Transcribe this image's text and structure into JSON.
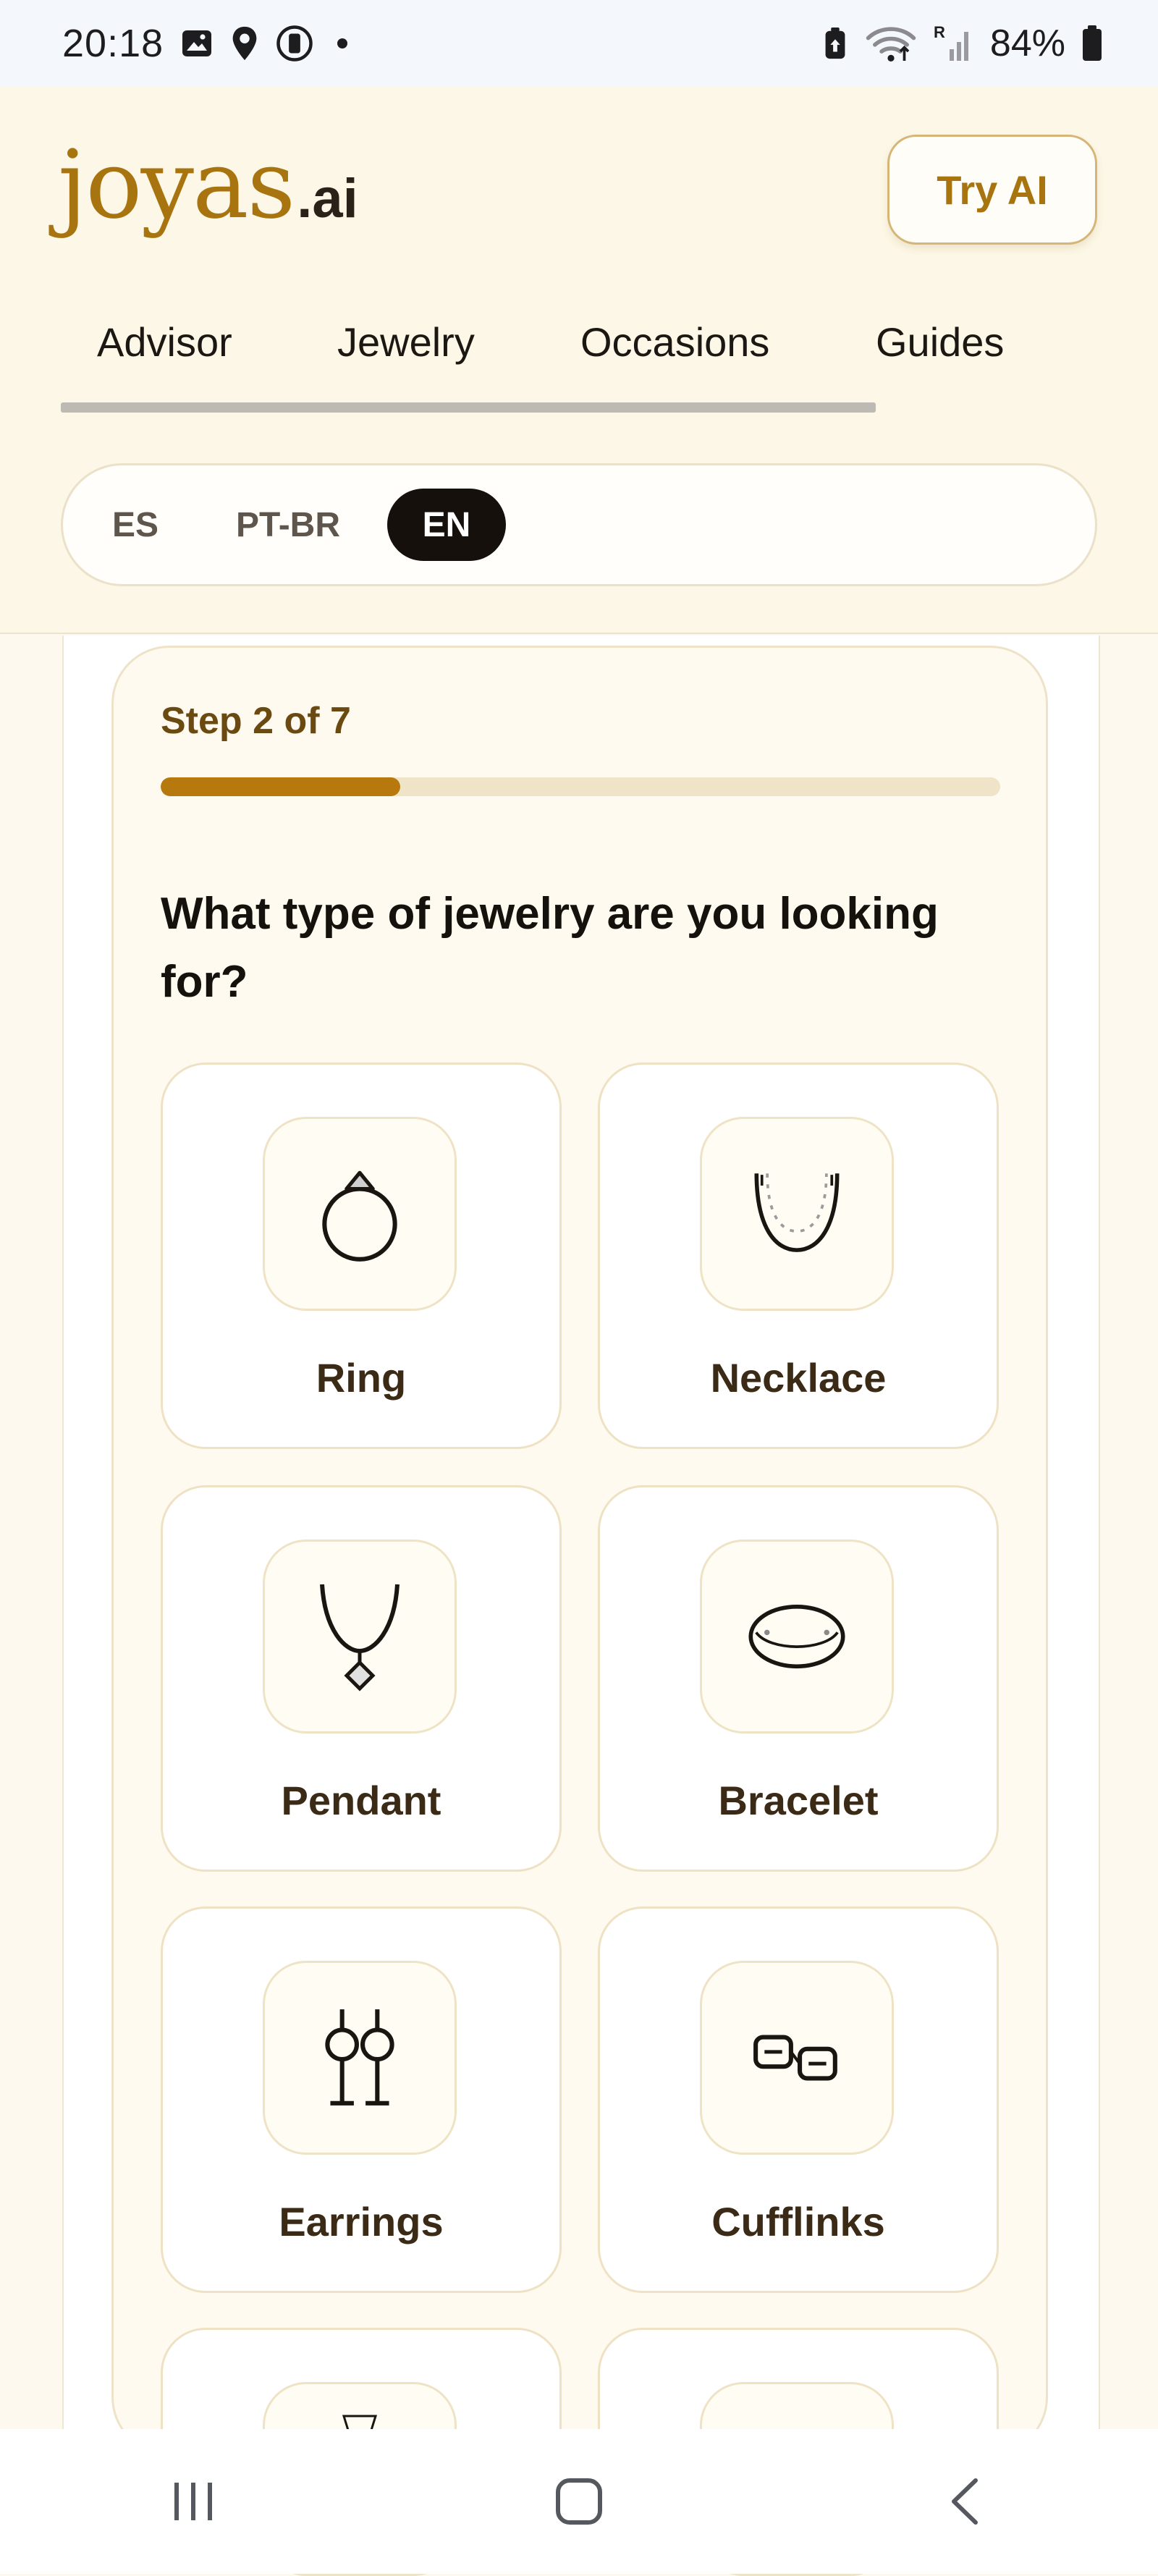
{
  "status_bar": {
    "time": "20:18",
    "battery_text": "84%",
    "left_icons": [
      "gallery-icon",
      "location-icon",
      "vpn-icon",
      "dot-icon"
    ],
    "right_icons": [
      "battery-saver-icon",
      "wifi-icon",
      "signal-icon",
      "battery-icon"
    ]
  },
  "header": {
    "logo_main": "joyas",
    "logo_suffix": ".ai",
    "try_button": "Try AI",
    "nav": [
      {
        "label": "Advisor"
      },
      {
        "label": "Jewelry"
      },
      {
        "label": "Occasions"
      },
      {
        "label": "Guides"
      }
    ],
    "languages": [
      {
        "label": "ES",
        "active": false
      },
      {
        "label": "PT-BR",
        "active": false
      },
      {
        "label": "EN",
        "active": true
      }
    ]
  },
  "quiz": {
    "step_label": "Step 2 of 7",
    "progress_fraction": 0.2857,
    "question": "What type of jewelry are you looking for?",
    "options": [
      {
        "label": "Ring",
        "icon": "ring-icon"
      },
      {
        "label": "Necklace",
        "icon": "necklace-icon"
      },
      {
        "label": "Pendant",
        "icon": "pendant-icon"
      },
      {
        "label": "Bracelet",
        "icon": "bracelet-icon"
      },
      {
        "label": "Earrings",
        "icon": "earrings-icon"
      },
      {
        "label": "Cufflinks",
        "icon": "cufflinks-icon"
      }
    ]
  },
  "colors": {
    "accent": "#b7790e",
    "logo": "#a8740f",
    "active_lang_bg": "#15100c"
  },
  "system_nav": [
    "recents-icon",
    "home-icon",
    "back-icon"
  ]
}
